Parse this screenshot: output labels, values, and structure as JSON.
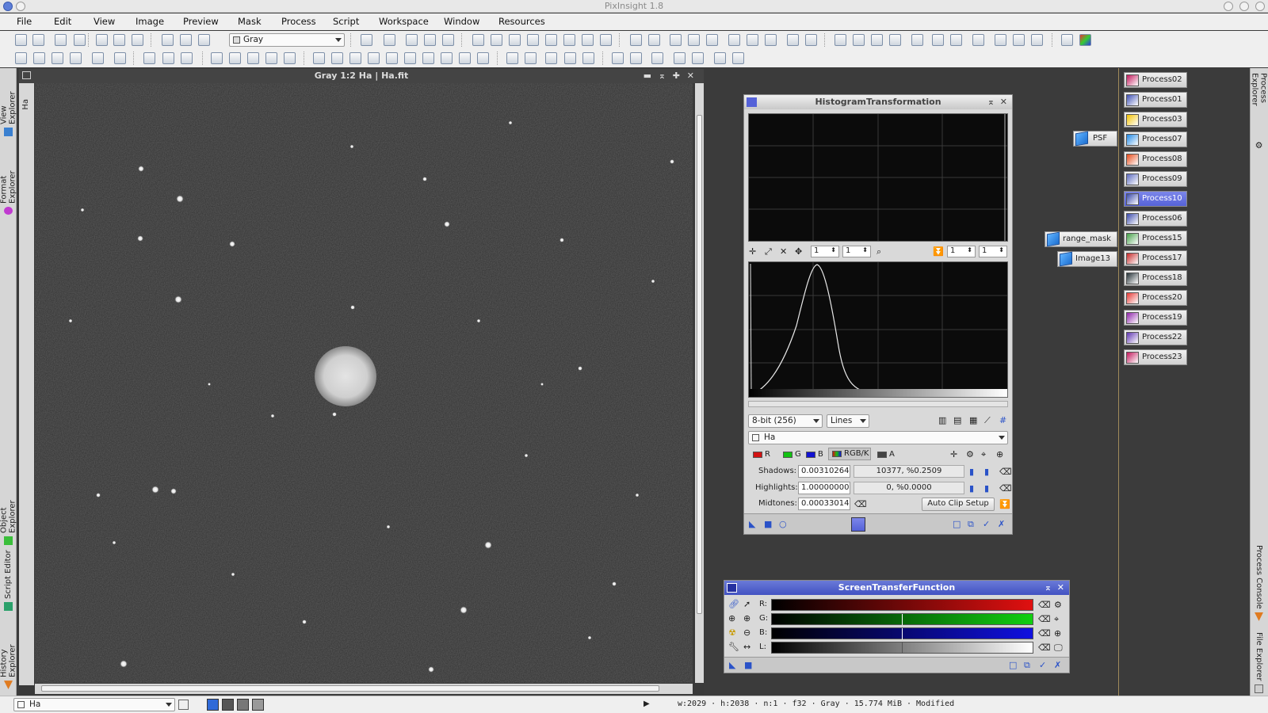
{
  "app": {
    "title": "PixInsight 1.8"
  },
  "menu": [
    "File",
    "Edit",
    "View",
    "Image",
    "Preview",
    "Mask",
    "Process",
    "Script",
    "Workspace",
    "Window",
    "Resources"
  ],
  "toolbar": {
    "colorspace_combo": "Gray"
  },
  "left_dock": {
    "tabs": [
      "View Explorer",
      "Format Explorer",
      "Object Explorer",
      "Script Editor",
      "History Explorer"
    ]
  },
  "image_window": {
    "title": "Gray 1:2 Ha | Ha.fit",
    "side_label": "Ha"
  },
  "histogram": {
    "title": "HistogramTransformation",
    "zoom_x": "1",
    "zoom_y": "1",
    "zoom_x2": "1",
    "zoom_y2": "1",
    "resolution": "8-bit (256)",
    "graph_style": "Lines",
    "view_selector": "Ha",
    "channels": {
      "r": "R",
      "g": "G",
      "b": "B",
      "rgbk": "RGB/K",
      "a": "A"
    },
    "shadows_label": "Shadows:",
    "shadows_value": "0.00310264",
    "shadows_clip": "10377, %0.2509",
    "highlights_label": "Highlights:",
    "highlights_value": "1.00000000",
    "highlights_clip": "0, %0.0000",
    "midtones_label": "Midtones:",
    "midtones_value": "0.00033014",
    "auto_clip_button": "Auto Clip Setup"
  },
  "stf": {
    "title": "ScreenTransferFunction",
    "rows": [
      "R:",
      "G:",
      "B:",
      "L:"
    ],
    "colors": {
      "r": "#e01010",
      "g": "#10d010",
      "b": "#1010e0",
      "l": "#ffffff"
    }
  },
  "workspace_icons": {
    "psf": "PSF",
    "range_mask": "range_mask",
    "image13": "Image13"
  },
  "process_icons": [
    {
      "label": "Process02",
      "color": "#c2185b"
    },
    {
      "label": "Process01",
      "color": "#3f51b5"
    },
    {
      "label": "Process03",
      "color": "#f2c200"
    },
    {
      "label": "Process07",
      "color": "#1e88e5"
    },
    {
      "label": "Process08",
      "color": "#e64a19"
    },
    {
      "label": "Process09",
      "color": "#5c6bc0"
    },
    {
      "label": "Process10",
      "color": "#3949ab",
      "selected": true
    },
    {
      "label": "Process06",
      "color": "#3949ab"
    },
    {
      "label": "Process15",
      "color": "#43a047"
    },
    {
      "label": "Process17",
      "color": "#c62828"
    },
    {
      "label": "Process18",
      "color": "#263238"
    },
    {
      "label": "Process20",
      "color": "#e53935"
    },
    {
      "label": "Process19",
      "color": "#8e24aa"
    },
    {
      "label": "Process22",
      "color": "#5e35b1"
    },
    {
      "label": "Process23",
      "color": "#c2185b"
    }
  ],
  "right_dock": {
    "tabs": [
      "Process Explorer",
      "Process Console",
      "File Explorer"
    ]
  },
  "status": {
    "view_combo": "Ha",
    "info": "w:2029 · h:2038 · n:1 · f32 · Gray · 15.774 MiB · Modified"
  }
}
